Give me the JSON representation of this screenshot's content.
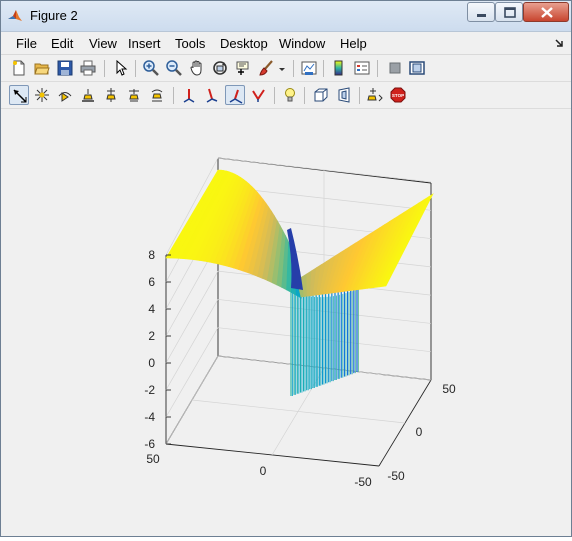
{
  "window": {
    "title": "Figure 2"
  },
  "menu": [
    "File",
    "Edit",
    "View",
    "Insert",
    "Tools",
    "Desktop",
    "Window",
    "Help"
  ],
  "toolbar1": [
    "new-figure-icon",
    "open-file-icon",
    "save-icon",
    "print-icon",
    "pointer-icon",
    "zoom-in-icon",
    "zoom-out-icon",
    "pan-hand-icon",
    "rotate-3d-icon",
    "data-cursor-icon",
    "brush-icon",
    "brush-dropdown-icon",
    "link-plot-icon",
    "insert-colorbar-icon",
    "insert-legend-icon",
    "hide-plot-tools-icon",
    "show-plot-tools-icon"
  ],
  "toolbar2": [
    "edit-plot-icon",
    "move-light-icon",
    "orbit-camera-icon",
    "dolly-camera-icon",
    "pan-tilt-camera-icon",
    "walk-camera-icon",
    "roll-camera-icon",
    "principal-axis-x-icon",
    "principal-axis-y-icon",
    "principal-axis-z-icon",
    "principal-axis-none-icon",
    "toggle-scene-light-icon",
    "orthographic-projection-icon",
    "perspective-projection-icon",
    "reset-camera-icon",
    "stop-camera-icon"
  ],
  "chart_data": {
    "type": "surface",
    "title": "",
    "xlabel": "",
    "ylabel": "",
    "zlabel": "",
    "z_ticks": [
      "8",
      "6",
      "4",
      "2",
      "0",
      "-2",
      "-4",
      "-6"
    ],
    "zlim": [
      -6,
      8
    ],
    "x_ticks": [
      "50",
      "0",
      "-50"
    ],
    "xlim": [
      -50,
      50
    ],
    "y_ticks": [
      "50",
      "0",
      "-50"
    ],
    "ylim": [
      -50,
      50
    ],
    "grid": true,
    "colormap": "parula",
    "colormap_colors": [
      "#352a87",
      "#0f5cdd",
      "#1481d6",
      "#06a4ca",
      "#2eb7a4",
      "#87bf77",
      "#d1bb59",
      "#fec832",
      "#f9fb0e"
    ],
    "surface_description_values": {
      "edge_height_left": 7.5,
      "edge_height_right": 7.8,
      "valley_min_height": 5.2,
      "spike_bottom": -2.5
    }
  }
}
